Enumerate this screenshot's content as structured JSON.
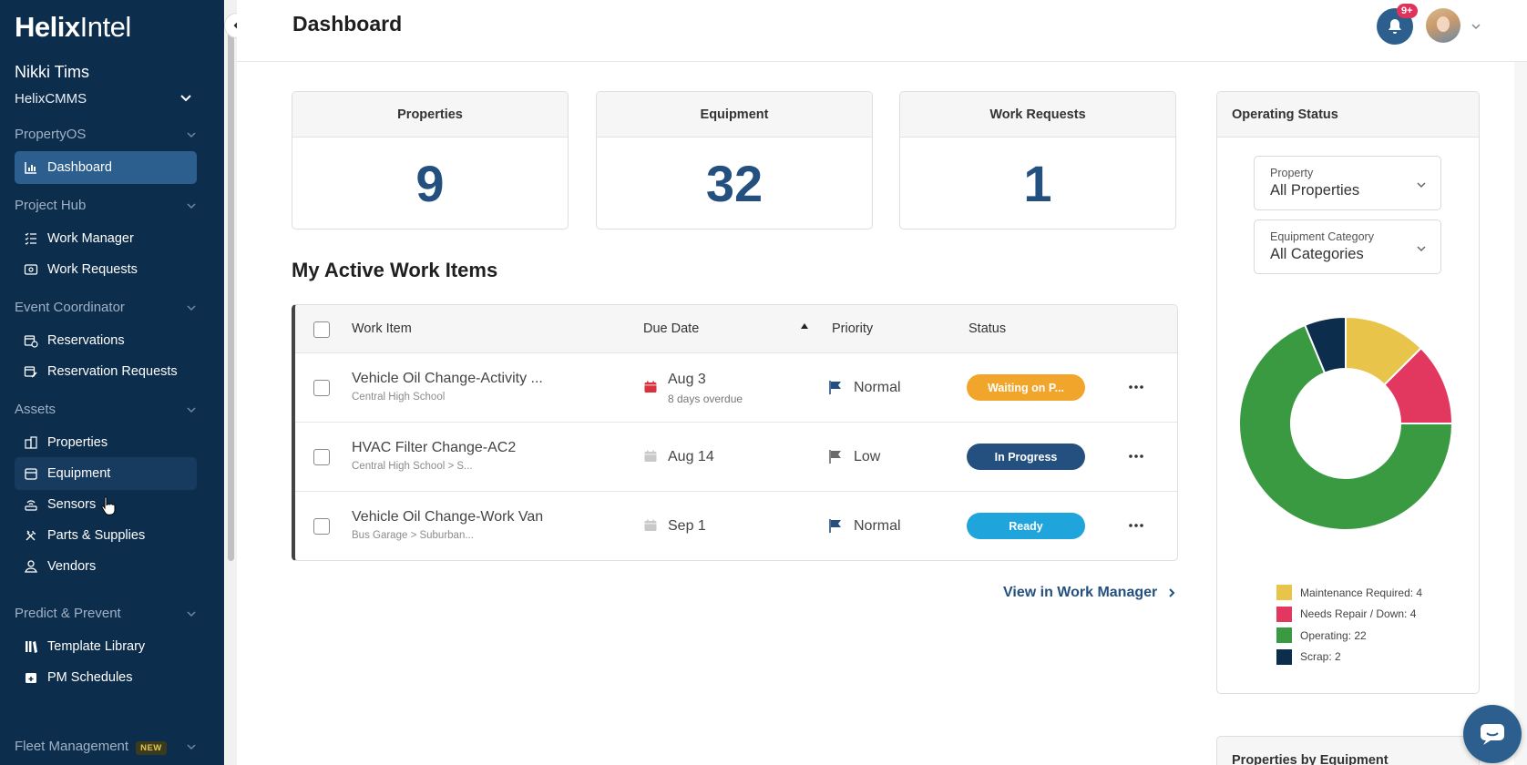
{
  "app": {
    "logo_bold": "Helix",
    "logo_light": "Intel",
    "user_name": "Nikki Tims",
    "org": "HelixCMMS"
  },
  "sidebar": {
    "sections": [
      {
        "label": "PropertyOS"
      },
      {
        "label": "Project Hub"
      },
      {
        "label": "Event Coordinator"
      },
      {
        "label": "Assets"
      },
      {
        "label": "Predict & Prevent"
      },
      {
        "label": "Fleet Management",
        "badge": "NEW"
      }
    ],
    "items": [
      {
        "label": "Dashboard",
        "icon": "chart-bar-icon",
        "active": true
      },
      {
        "label": "Work Manager",
        "icon": "list-check-icon"
      },
      {
        "label": "Work Requests",
        "icon": "inbox-icon"
      },
      {
        "label": "Reservations",
        "icon": "calendar-clock-icon"
      },
      {
        "label": "Reservation Requests",
        "icon": "calendar-edit-icon"
      },
      {
        "label": "Properties",
        "icon": "buildings-icon"
      },
      {
        "label": "Equipment",
        "icon": "equipment-icon",
        "hovered": true
      },
      {
        "label": "Sensors",
        "icon": "sensor-icon"
      },
      {
        "label": "Parts & Supplies",
        "icon": "tools-icon"
      },
      {
        "label": "Vendors",
        "icon": "vendor-icon"
      },
      {
        "label": "Template Library",
        "icon": "library-icon"
      },
      {
        "label": "PM Schedules",
        "icon": "calendar-plus-icon"
      }
    ]
  },
  "header": {
    "title": "Dashboard",
    "notification_count": "9+"
  },
  "stats": [
    {
      "label": "Properties",
      "value": "9"
    },
    {
      "label": "Equipment",
      "value": "32"
    },
    {
      "label": "Work Requests",
      "value": "1"
    }
  ],
  "work_items": {
    "title": "My Active Work Items",
    "columns": {
      "item": "Work Item",
      "due": "Due Date",
      "priority": "Priority",
      "status": "Status"
    },
    "rows": [
      {
        "title": "Vehicle Oil Change-Activity ...",
        "sub": "Central High School",
        "due": "Aug 3",
        "overdue": "8 days overdue",
        "priority": "Normal",
        "status": "Waiting on P...",
        "status_color": "#f2a52b",
        "cal_color": "#d8323f",
        "flag_color": "#24507f"
      },
      {
        "title": "HVAC Filter Change-AC2",
        "sub": "Central High School > S...",
        "due": "Aug 14",
        "overdue": "",
        "priority": "Low",
        "status": "In Progress",
        "status_color": "#24507f",
        "cal_color": "#c9c9c9",
        "flag_color": "#6b6b6b"
      },
      {
        "title": "Vehicle Oil Change-Work Van",
        "sub": "Bus Garage > Suburban...",
        "due": "Sep 1",
        "overdue": "",
        "priority": "Normal",
        "status": "Ready",
        "status_color": "#1fa5dc",
        "cal_color": "#c9c9c9",
        "flag_color": "#24507f"
      }
    ],
    "view_link": "View in Work Manager"
  },
  "operating_status": {
    "title": "Operating Status",
    "property_label": "Property",
    "property_value": "All Properties",
    "category_label": "Equipment Category",
    "category_value": "All Categories",
    "legend": [
      {
        "label": "Maintenance Required: 4",
        "color": "#e9c44b"
      },
      {
        "label": "Needs Repair / Down: 4",
        "color": "#e2375f"
      },
      {
        "label": "Operating: 22",
        "color": "#3a9a42"
      },
      {
        "label": "Scrap: 2",
        "color": "#0d2d4c"
      }
    ]
  },
  "chart_data": {
    "type": "pie",
    "title": "Operating Status",
    "categories": [
      "Maintenance Required",
      "Needs Repair / Down",
      "Operating",
      "Scrap"
    ],
    "values": [
      4,
      4,
      22,
      2
    ],
    "colors": [
      "#e9c44b",
      "#e2375f",
      "#3a9a42",
      "#0d2d4c"
    ],
    "donut": true
  },
  "properties_by_equipment": {
    "title": "Properties by Equipment"
  }
}
